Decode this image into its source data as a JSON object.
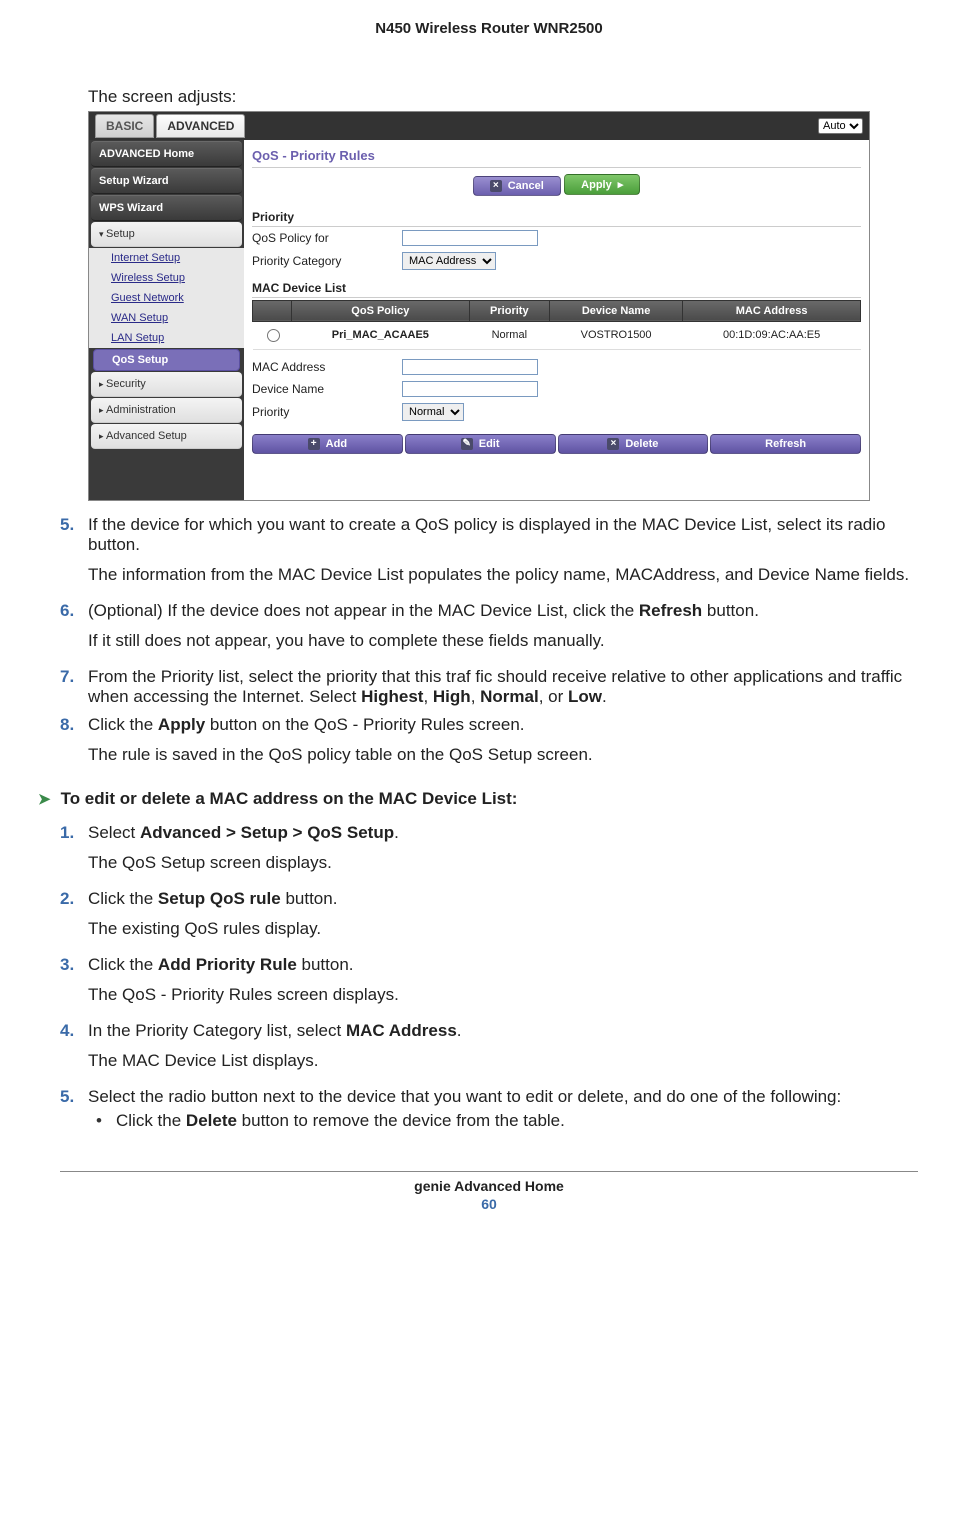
{
  "doc_header": "N450 Wireless Router WNR2500",
  "lead": "The screen adjusts:",
  "screenshot": {
    "tabs": {
      "basic": "BASIC",
      "advanced": "ADVANCED"
    },
    "top_select": "Auto",
    "sidebar": {
      "adv_home": "ADVANCED Home",
      "setup_wizard": "Setup Wizard",
      "wps_wizard": "WPS Wizard",
      "setup": "Setup",
      "setup_items": {
        "internet": "Internet Setup",
        "wireless": "Wireless Setup",
        "guest": "Guest Network",
        "wan": "WAN Setup",
        "lan": "LAN Setup",
        "qos": "QoS Setup"
      },
      "security": "Security",
      "administration": "Administration",
      "advanced_setup": "Advanced Setup"
    },
    "panel_title": "QoS - Priority Rules",
    "btn_cancel": "Cancel",
    "btn_apply": "Apply",
    "priority_section": "Priority",
    "qos_policy_label": "QoS Policy for",
    "priority_category_label": "Priority Category",
    "priority_category_value": "MAC Address",
    "mac_list_label": "MAC Device List",
    "table": {
      "headers": {
        "policy": "QoS Policy",
        "priority": "Priority",
        "device": "Device Name",
        "mac": "MAC Address"
      },
      "row": {
        "policy": "Pri_MAC_ACAAE5",
        "priority": "Normal",
        "device": "VOSTRO1500",
        "mac": "00:1D:09:AC:AA:E5"
      }
    },
    "mac_address_label": "MAC Address",
    "device_name_label": "Device Name",
    "priority_label": "Priority",
    "priority_value": "Normal",
    "btn_add": "Add",
    "btn_edit": "Edit",
    "btn_delete": "Delete",
    "btn_refresh": "Refresh"
  },
  "steps_a": {
    "5": {
      "p1": "If the device for which you want to create a QoS policy is displayed in the MAC Device List, select its radio button.",
      "p2": "The information from the MAC Device List populates the policy name, MACAddress, and Device Name fields."
    },
    "6": {
      "p1a": "(Optional) If the device does not appear in the MAC Device List, click the ",
      "p1b": "Refresh",
      "p1c": " button.",
      "p2": "If it still does not appear, you have to complete these fields manually."
    },
    "7": {
      "p1a": "From the Priority list, select the priority that this traf fic should receive relative to other applications and traffic when accessing the Internet. Select ",
      "b1": "Highest",
      "c1": ", ",
      "b2": "High",
      "c2": ", ",
      "b3": "Normal",
      "c3": ", or ",
      "b4": "Low",
      "c4": "."
    },
    "8": {
      "p1a": "Click the ",
      "p1b": "Apply",
      "p1c": " button on the QoS - Priority Rules screen.",
      "p2": "The rule is saved in the QoS policy table on the QoS Setup screen."
    }
  },
  "proc_heading": "To edit or delete a MAC address on the MAC Device List:",
  "steps_b": {
    "1": {
      "p1a": "Select ",
      "p1b": "Advanced > Setup > QoS Setup",
      "p1c": ".",
      "p2": "The QoS Setup screen displays."
    },
    "2": {
      "p1a": "Click the ",
      "p1b": "Setup QoS rule",
      "p1c": " button.",
      "p2": "The existing QoS rules display."
    },
    "3": {
      "p1a": "Click the ",
      "p1b": "Add Priority Rule",
      "p1c": " button.",
      "p2": "The QoS - Priority Rules screen displays."
    },
    "4": {
      "p1a": "In the Priority Category list, select ",
      "p1b": "MAC Address",
      "p1c": ".",
      "p2": "The MAC Device List displays."
    },
    "5": {
      "p1": "Select the radio button next to the device that you want to edit or delete, and do one of the following:",
      "bullet_a": "Click the ",
      "bullet_b": "Delete",
      "bullet_c": " button to remove the device from the table."
    }
  },
  "footer_title": "genie Advanced Home",
  "page_num": "60"
}
